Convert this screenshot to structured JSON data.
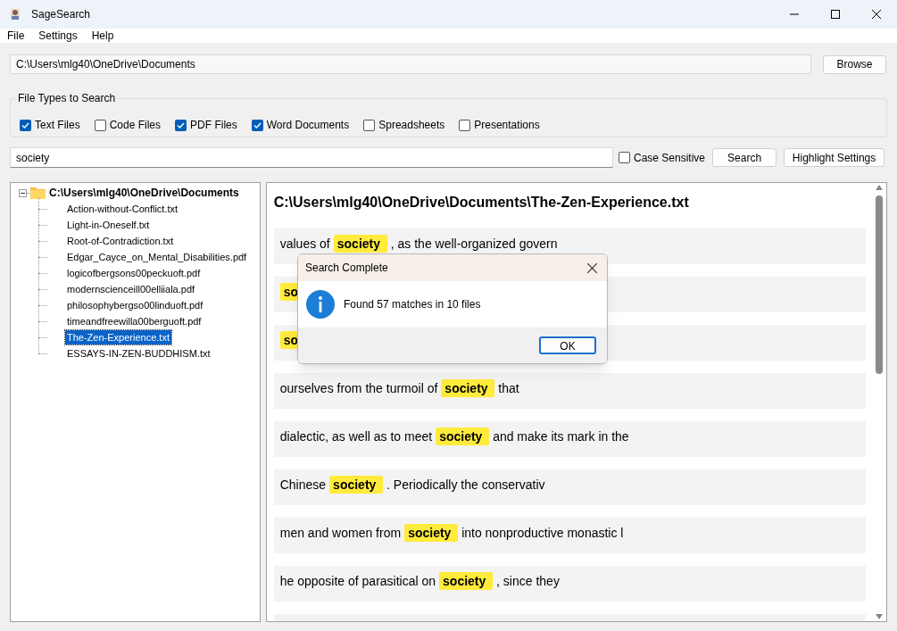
{
  "window": {
    "title": "SageSearch"
  },
  "menu": [
    "File",
    "Settings",
    "Help"
  ],
  "folder": {
    "path": "C:\\Users\\mlg40\\OneDrive\\Documents",
    "button": "Browse"
  },
  "file_types": {
    "title": "File Types to Search",
    "options": [
      {
        "label": "Text Files",
        "checked": true
      },
      {
        "label": "Code Files",
        "checked": false
      },
      {
        "label": "PDF Files",
        "checked": true
      },
      {
        "label": "Word Documents",
        "checked": true
      },
      {
        "label": "Spreadsheets",
        "checked": false
      },
      {
        "label": "Presentations",
        "checked": false
      }
    ]
  },
  "search": {
    "value": "society",
    "case_sensitive": {
      "label": "Case Sensitive",
      "checked": false
    },
    "search_button": "Search",
    "highlight_button": "Highlight Settings"
  },
  "tree": {
    "label": "C:\\Users\\mlg40\\OneDrive\\Documents",
    "expanded": true,
    "children": [
      {
        "label": "Action-without-Conflict.txt",
        "selected": false
      },
      {
        "label": "Light-in-Oneself.txt",
        "selected": false
      },
      {
        "label": "Root-of-Contradiction.txt",
        "selected": false
      },
      {
        "label": "Edgar_Cayce_on_Mental_Disabilities.pdf",
        "selected": false
      },
      {
        "label": "logicofbergsons00peckuoft.pdf",
        "selected": false
      },
      {
        "label": "modernscienceill00elliiala.pdf",
        "selected": false
      },
      {
        "label": "philosophybergso00linduoft.pdf",
        "selected": false
      },
      {
        "label": "timeandfreewilla00berguoft.pdf",
        "selected": false
      },
      {
        "label": "The-Zen-Experience.txt",
        "selected": true
      },
      {
        "label": "ESSAYS-IN-ZEN-BUDDHISM.txt",
        "selected": false
      }
    ]
  },
  "results": {
    "title": "C:\\Users\\mlg40\\OneDrive\\Documents\\The-Zen-Experience.txt",
    "matches": [
      {
        "before": "values of",
        "match": "society",
        "after": ", as the well-organized govern"
      },
      {
        "match": "so"
      },
      {
        "match": "so"
      },
      {
        "before": "ourselves from the turmoil of",
        "match": "society",
        "after": "that"
      },
      {
        "before": "dialectic, as well as to meet",
        "match": "society",
        "after": "and make its mark in the"
      },
      {
        "before": "Chinese",
        "match": "society",
        "after": ". Periodically the conservativ"
      },
      {
        "before": "men and women from",
        "match": "society",
        "after": "into nonproductive monastic l"
      },
      {
        "before": "he opposite of parasitical on",
        "match": "society",
        "after": ", since they"
      }
    ]
  },
  "dialog": {
    "title": "Search Complete",
    "message": "Found 57 matches in 10 files",
    "button": "OK"
  }
}
